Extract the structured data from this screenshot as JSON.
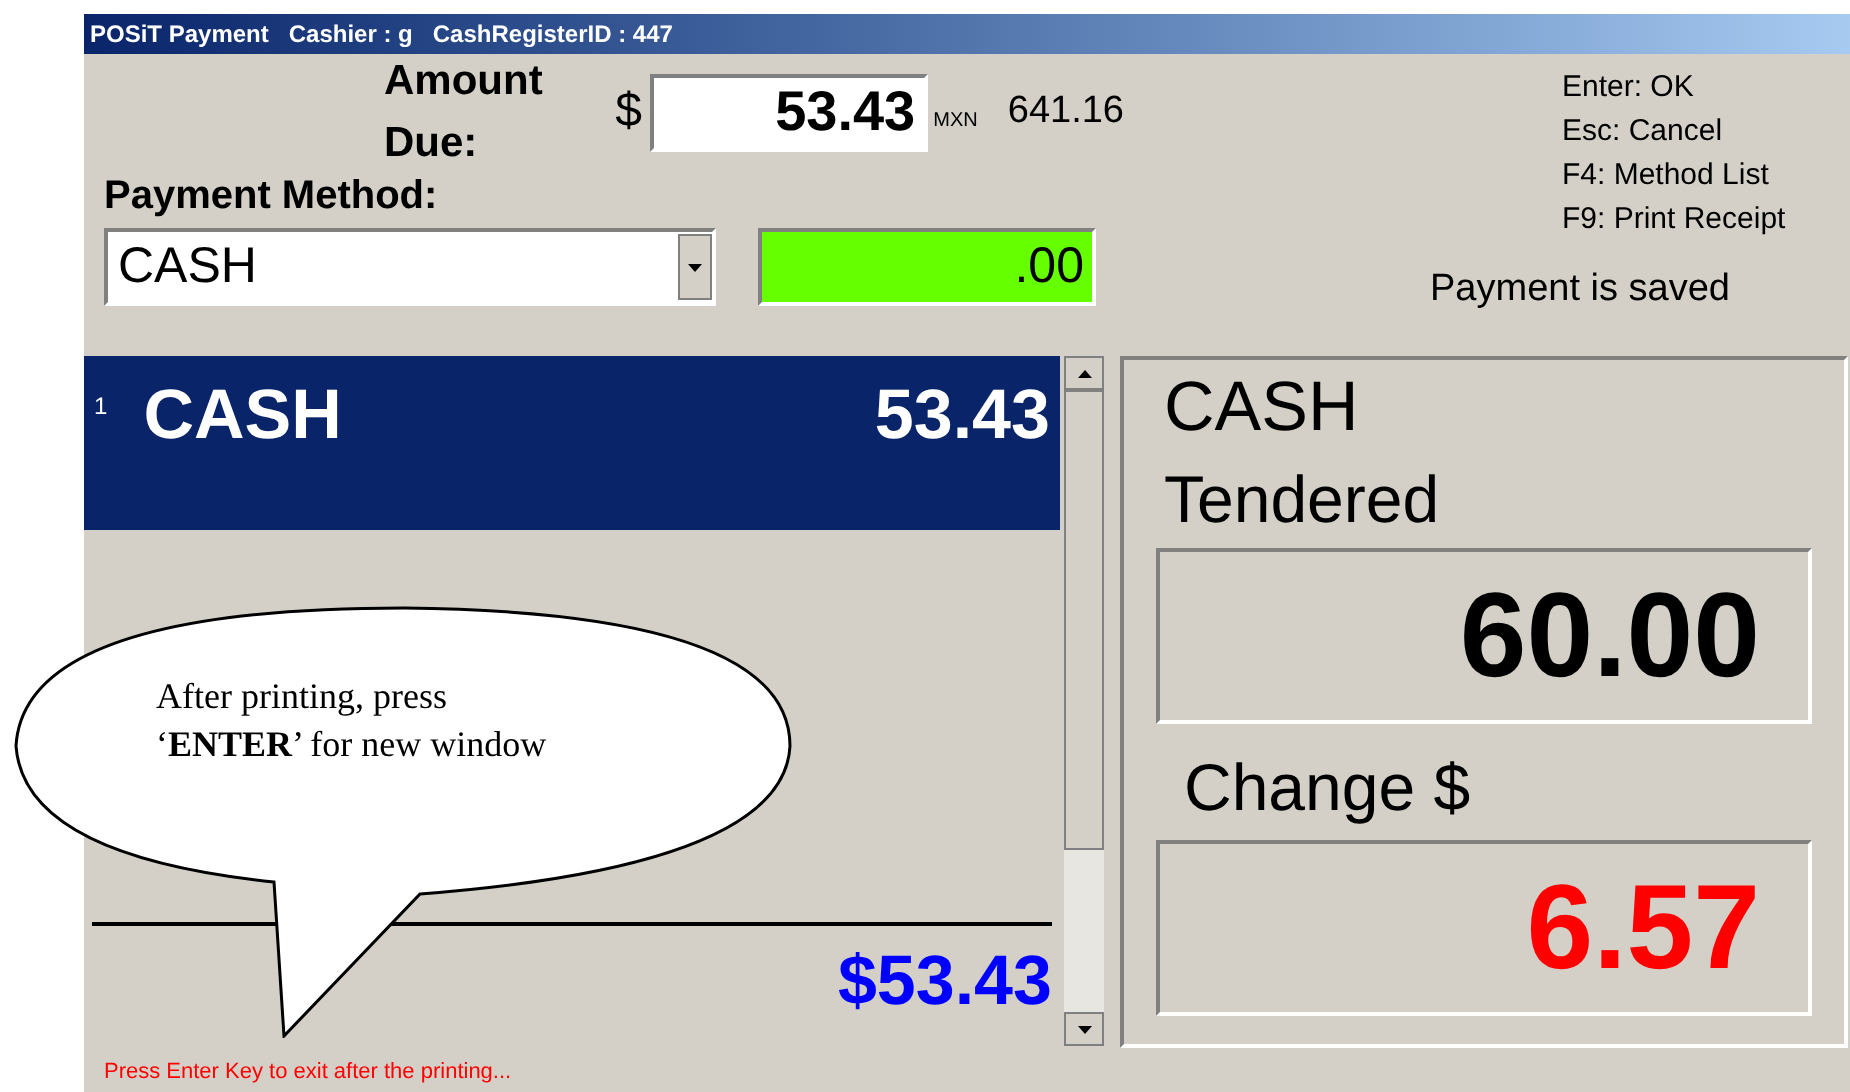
{
  "window": {
    "title": "POSiT Payment   Cashier : g   CashRegisterID : 447"
  },
  "amount_due": {
    "label": "Amount Due:",
    "currency_symbol": "$",
    "value": "53.43",
    "currency_code": "MXN",
    "converted": "641.16"
  },
  "shortcuts": [
    "Enter: OK",
    "Esc: Cancel",
    "F4: Method List",
    "F9: Print Receipt"
  ],
  "payment_method": {
    "label": "Payment Method:",
    "value": "CASH",
    "amount": ".00"
  },
  "status_message": "Payment is saved",
  "payments": [
    {
      "index": "1",
      "method": "CASH",
      "amount": "53.43",
      "selected": true
    }
  ],
  "total": "$53.43",
  "detail": {
    "method": "CASH",
    "tendered_label": "Tendered",
    "tendered": "60.00",
    "change_label": "Change $",
    "change": "6.57"
  },
  "callout": {
    "text": "After printing, press\n‘**ENTER**’ for new window"
  },
  "status_bar": "Press Enter Key to exit after the printing..."
}
